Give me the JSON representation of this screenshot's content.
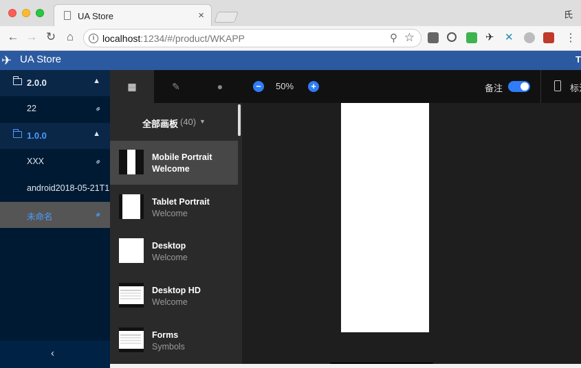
{
  "browser": {
    "tab_title": "UA Store",
    "tab_close": "×",
    "profile": "氏",
    "url_host": "localhost",
    "url_path": ":1234/#/product/WKAPP",
    "info_glyph": "i",
    "icons": [
      "back-arrow",
      "forward-arrow",
      "reload",
      "home",
      "zoom-magnifier",
      "bookmark-star",
      "menu-dots"
    ]
  },
  "app": {
    "title": "UA Store",
    "header_right": "T"
  },
  "sidebar": {
    "versions": [
      {
        "label": "2.0.0",
        "expanded": true,
        "items": [
          {
            "label": "22"
          }
        ]
      },
      {
        "label": "1.0.0",
        "expanded": true,
        "items": [
          {
            "label": "XXX"
          },
          {
            "label": "android2018-05-21T1"
          },
          {
            "label": "未命名",
            "selected": true
          }
        ]
      }
    ],
    "collapse_glyph": "‹"
  },
  "panel": {
    "all_boards_label": "全部画板",
    "count": "(40)",
    "artboards": [
      {
        "name": "Mobile Portrait",
        "page": "Welcome",
        "active": true
      },
      {
        "name": "Tablet Portrait",
        "page": "Welcome"
      },
      {
        "name": "Desktop",
        "page": "Welcome"
      },
      {
        "name": "Desktop HD",
        "page": "Welcome"
      },
      {
        "name": "Forms",
        "page": "Symbols"
      }
    ]
  },
  "canvas": {
    "zoom": "50%",
    "minus": "−",
    "plus": "+",
    "note_label": "备注",
    "note_enabled": true,
    "mark_label": "标注"
  },
  "colors": {
    "accent": "#2f7cf6",
    "header": "#2c5aa0",
    "sidebar": "#001a33"
  }
}
